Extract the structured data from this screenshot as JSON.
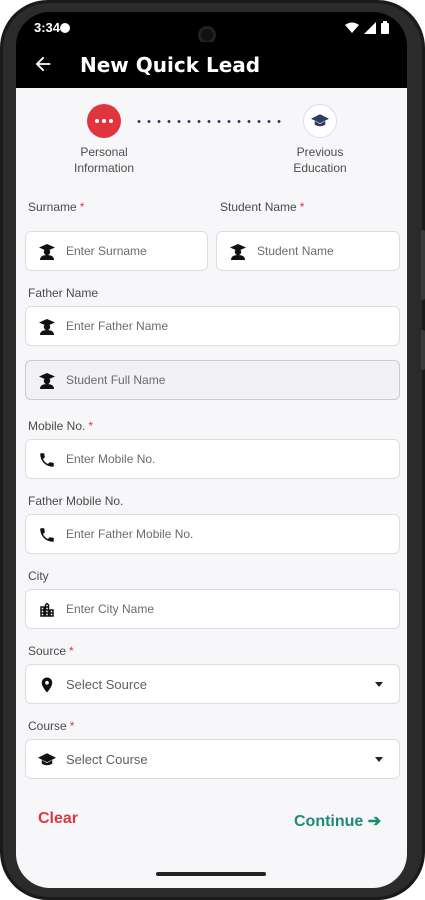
{
  "status": {
    "time": "3:34"
  },
  "appbar": {
    "title": "New Quick Lead"
  },
  "stepper": {
    "steps": [
      {
        "label_line1": "Personal",
        "label_line2": "Information",
        "active": true
      },
      {
        "label_line1": "Previous",
        "label_line2": "Education",
        "active": false
      }
    ]
  },
  "form": {
    "surname": {
      "label": "Surname",
      "required": "*",
      "placeholder": "Enter Surname"
    },
    "student_name": {
      "label": "Student Name",
      "required": "*",
      "placeholder": "Student Name"
    },
    "father_name": {
      "label": "Father Name",
      "placeholder": "Enter Father Name"
    },
    "student_full_name": {
      "placeholder": "Student Full Name"
    },
    "mobile": {
      "label": "Mobile No.",
      "required": "*",
      "placeholder": "Enter Mobile No."
    },
    "father_mobile": {
      "label": "Father Mobile No.",
      "placeholder": "Enter Father Mobile No."
    },
    "city": {
      "label": "City",
      "placeholder": "Enter City Name"
    },
    "source": {
      "label": "Source",
      "required": "*",
      "placeholder": "Select Source"
    },
    "course": {
      "label": "Course",
      "required": "*",
      "placeholder": "Select Course"
    }
  },
  "actions": {
    "clear": "Clear",
    "continue": "Continue ➔"
  },
  "colors": {
    "accent_red": "#e0343f",
    "accent_green": "#1f8a78",
    "step_navy": "#2f3a63"
  }
}
